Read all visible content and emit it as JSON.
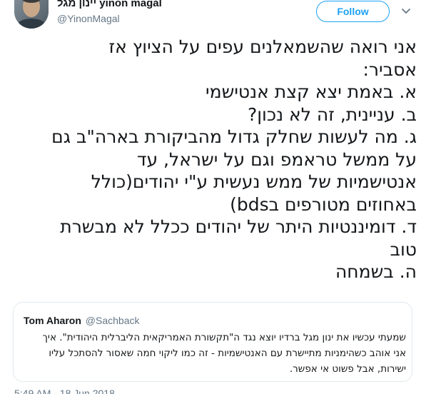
{
  "author": {
    "display_name": "יינון מגל yinon magal",
    "username": "@YinonMagal"
  },
  "follow_label": "Follow",
  "tweet_lines": [
    "אני רואה שהשמאלנים עפים על הציוץ אז",
    "אסביר:",
    "א. באמת יצא קצת אנטישמי",
    "ב. עניינית, זה לא נכון?",
    "ג. מה לעשות שחלק גדול מהביקורת בארה\"ב גם",
    "על ממשל טראמפ וגם על ישראל, עד",
    "אנטישמיות של ממש נעשית ע\"י יהודים(כולל",
    "באחוזים מטורפים בbds)",
    "ד. דומיננטיות היתר של יהודים ככלל לא מבשרת",
    "טוב",
    "ה. בשמחה"
  ],
  "quote": {
    "name": "Tom Aharon",
    "username": "@Sachback",
    "lines": [
      "שמעתי עכשיו את ינון מגל ברדיו יוצא נגד ה\"תקשורת האמריקאית הליברלית היהודית\". איך",
      "אני אוהב כשהימניות מתיישרת עם האנטישמיות - זה כמו ליקוי חמה שאסור להסתכל עליו",
      "ישירות, אבל פשוט אי אפשר."
    ]
  },
  "timestamp": "5:49 AM - 18 Jun 2018"
}
